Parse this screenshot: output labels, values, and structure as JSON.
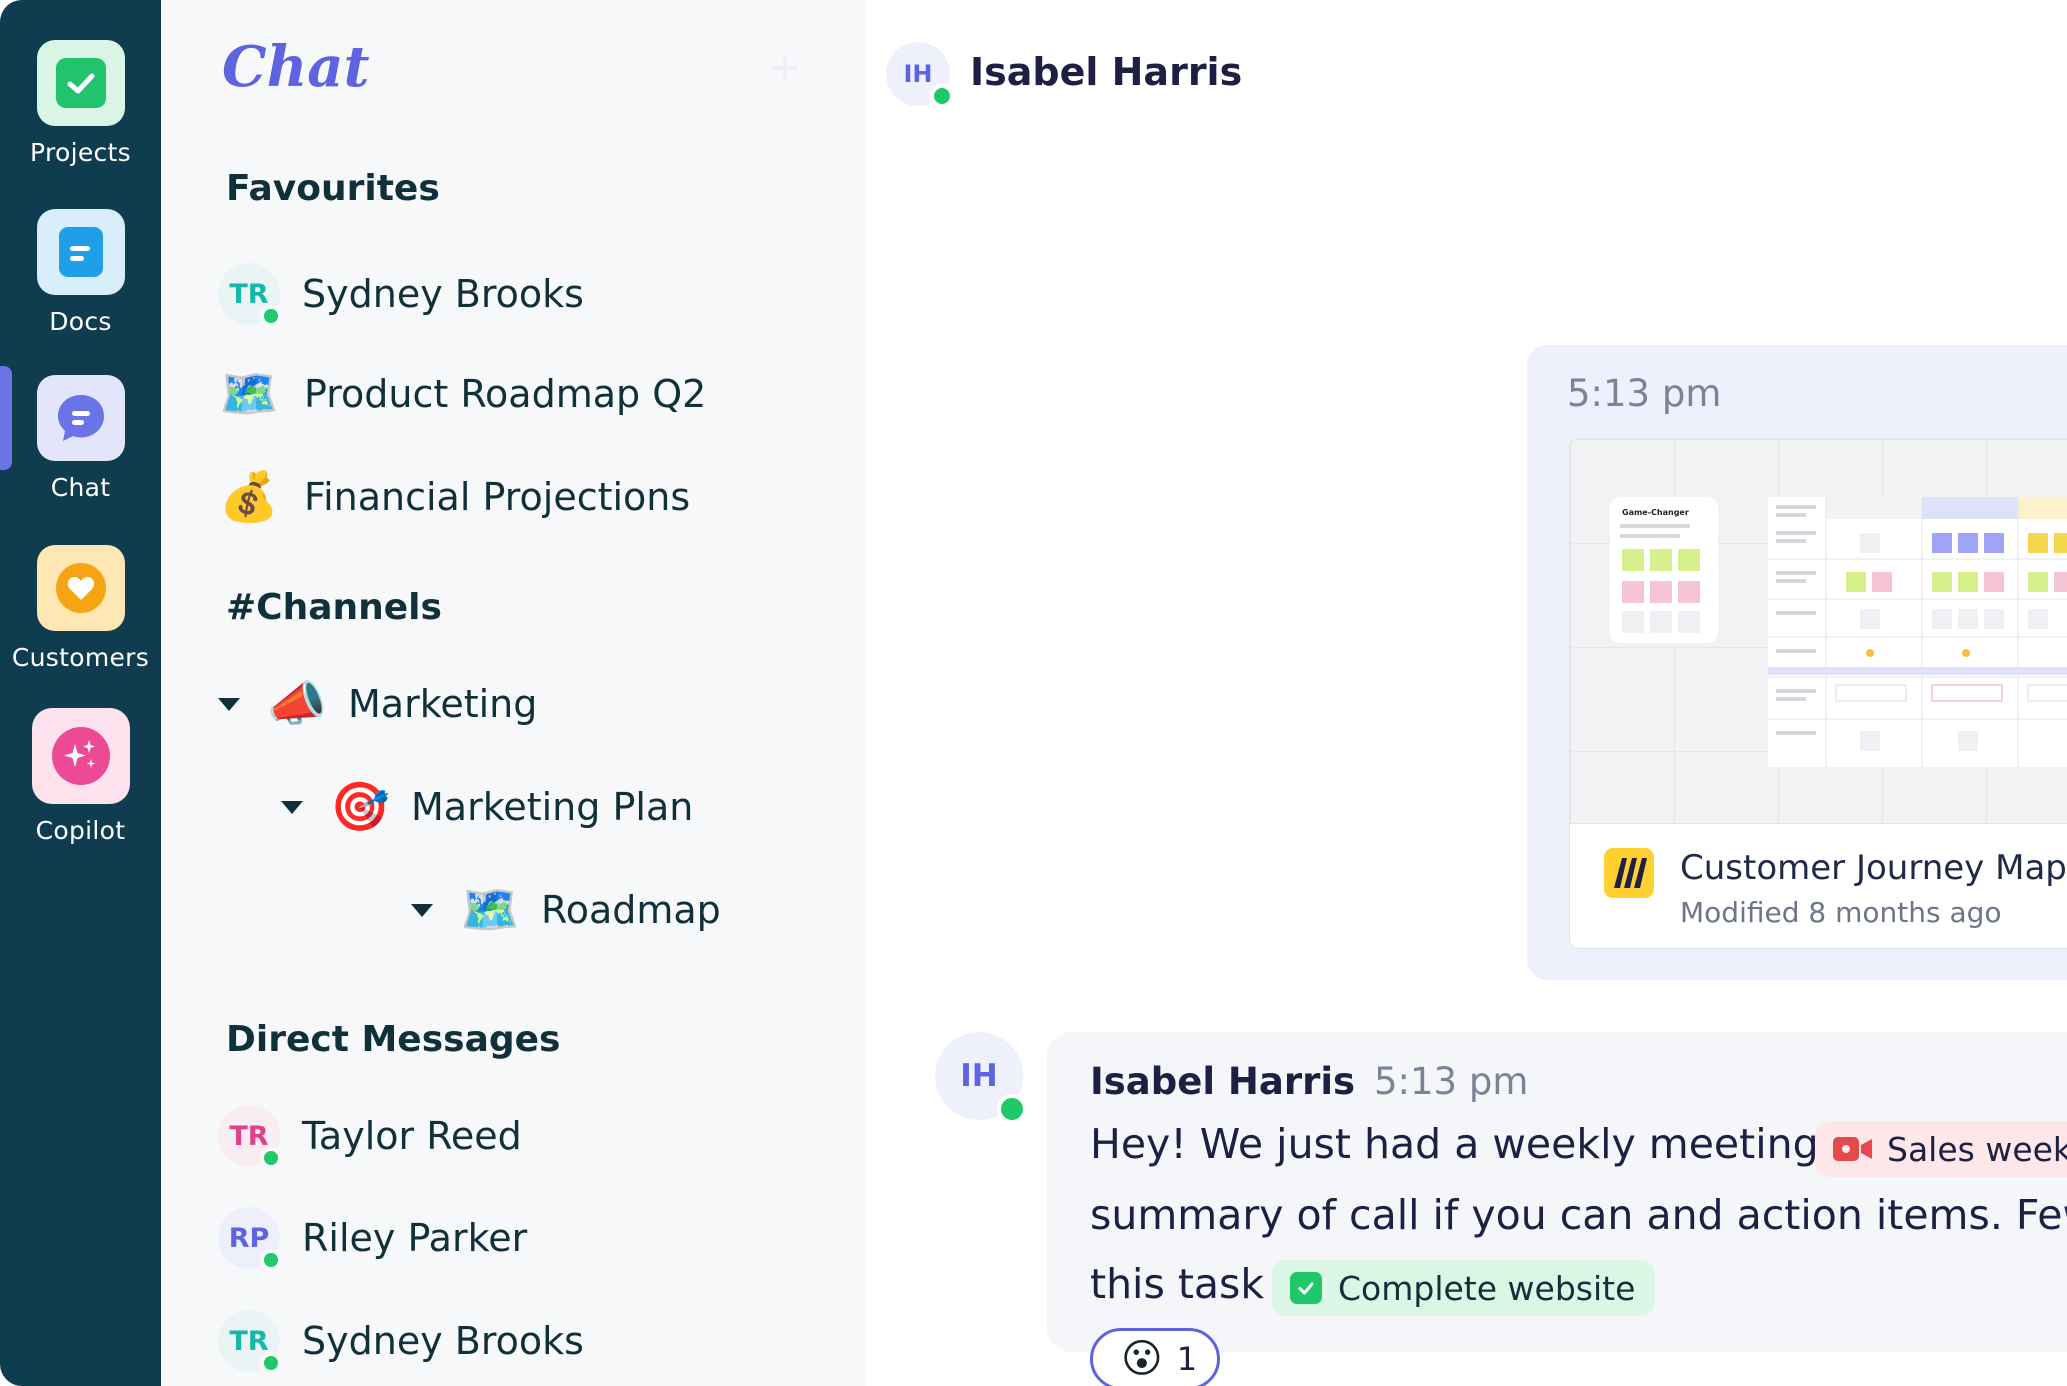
{
  "colors": {
    "rail_bg": "#0f3d4f",
    "accent": "#5e63e0",
    "online": "#1fc96a",
    "sidebar_bg": "#f7f8fa"
  },
  "rail": {
    "items": [
      {
        "label": "Projects",
        "icon": "check-icon"
      },
      {
        "label": "Docs",
        "icon": "document-icon"
      },
      {
        "label": "Chat",
        "icon": "chat-bubble-icon"
      },
      {
        "label": "Customers",
        "icon": "heart-icon"
      },
      {
        "label": "Copilot",
        "icon": "sparkles-icon"
      }
    ]
  },
  "sidebar": {
    "title": "Chat",
    "add_icon": "+",
    "favourites_heading": "Favourites",
    "favourites": [
      {
        "initials": "TR",
        "name": "Sydney Brooks"
      },
      {
        "emoji": "🗺️",
        "name": "Product Roadmap Q2"
      },
      {
        "emoji": "💰",
        "name": "Financial Projections"
      }
    ],
    "channels_heading": "#Channels",
    "channels": [
      {
        "emoji": "📣",
        "name": "Marketing"
      },
      {
        "emoji": "🎯",
        "name": "Marketing Plan"
      },
      {
        "emoji": "🗺️",
        "name": "Roadmap"
      }
    ],
    "dm_heading": "Direct Messages",
    "direct_messages": [
      {
        "initials": "TR",
        "name": "Taylor Reed"
      },
      {
        "initials": "RP",
        "name": "Riley Parker"
      },
      {
        "initials": "TR",
        "name": "Sydney Brooks"
      }
    ]
  },
  "header": {
    "initials": "IH",
    "name": "Isabel Harris"
  },
  "shared_file": {
    "time": "5:13 pm",
    "file_name": "Customer Journey Map",
    "modified": "Modified 8 months ago",
    "preview_title": "Game-Changer"
  },
  "message": {
    "initials": "IH",
    "author": "Isabel Harris",
    "time": "5:13 pm",
    "line1": "Hey! We just had a weekly meeting",
    "meeting_pill": "Sales weekly",
    "line2": "summary of call if you can and action items. Few",
    "line3": "this task",
    "task_pill": "Complete website",
    "reaction_emoji": "😮",
    "reaction_count": "1"
  }
}
